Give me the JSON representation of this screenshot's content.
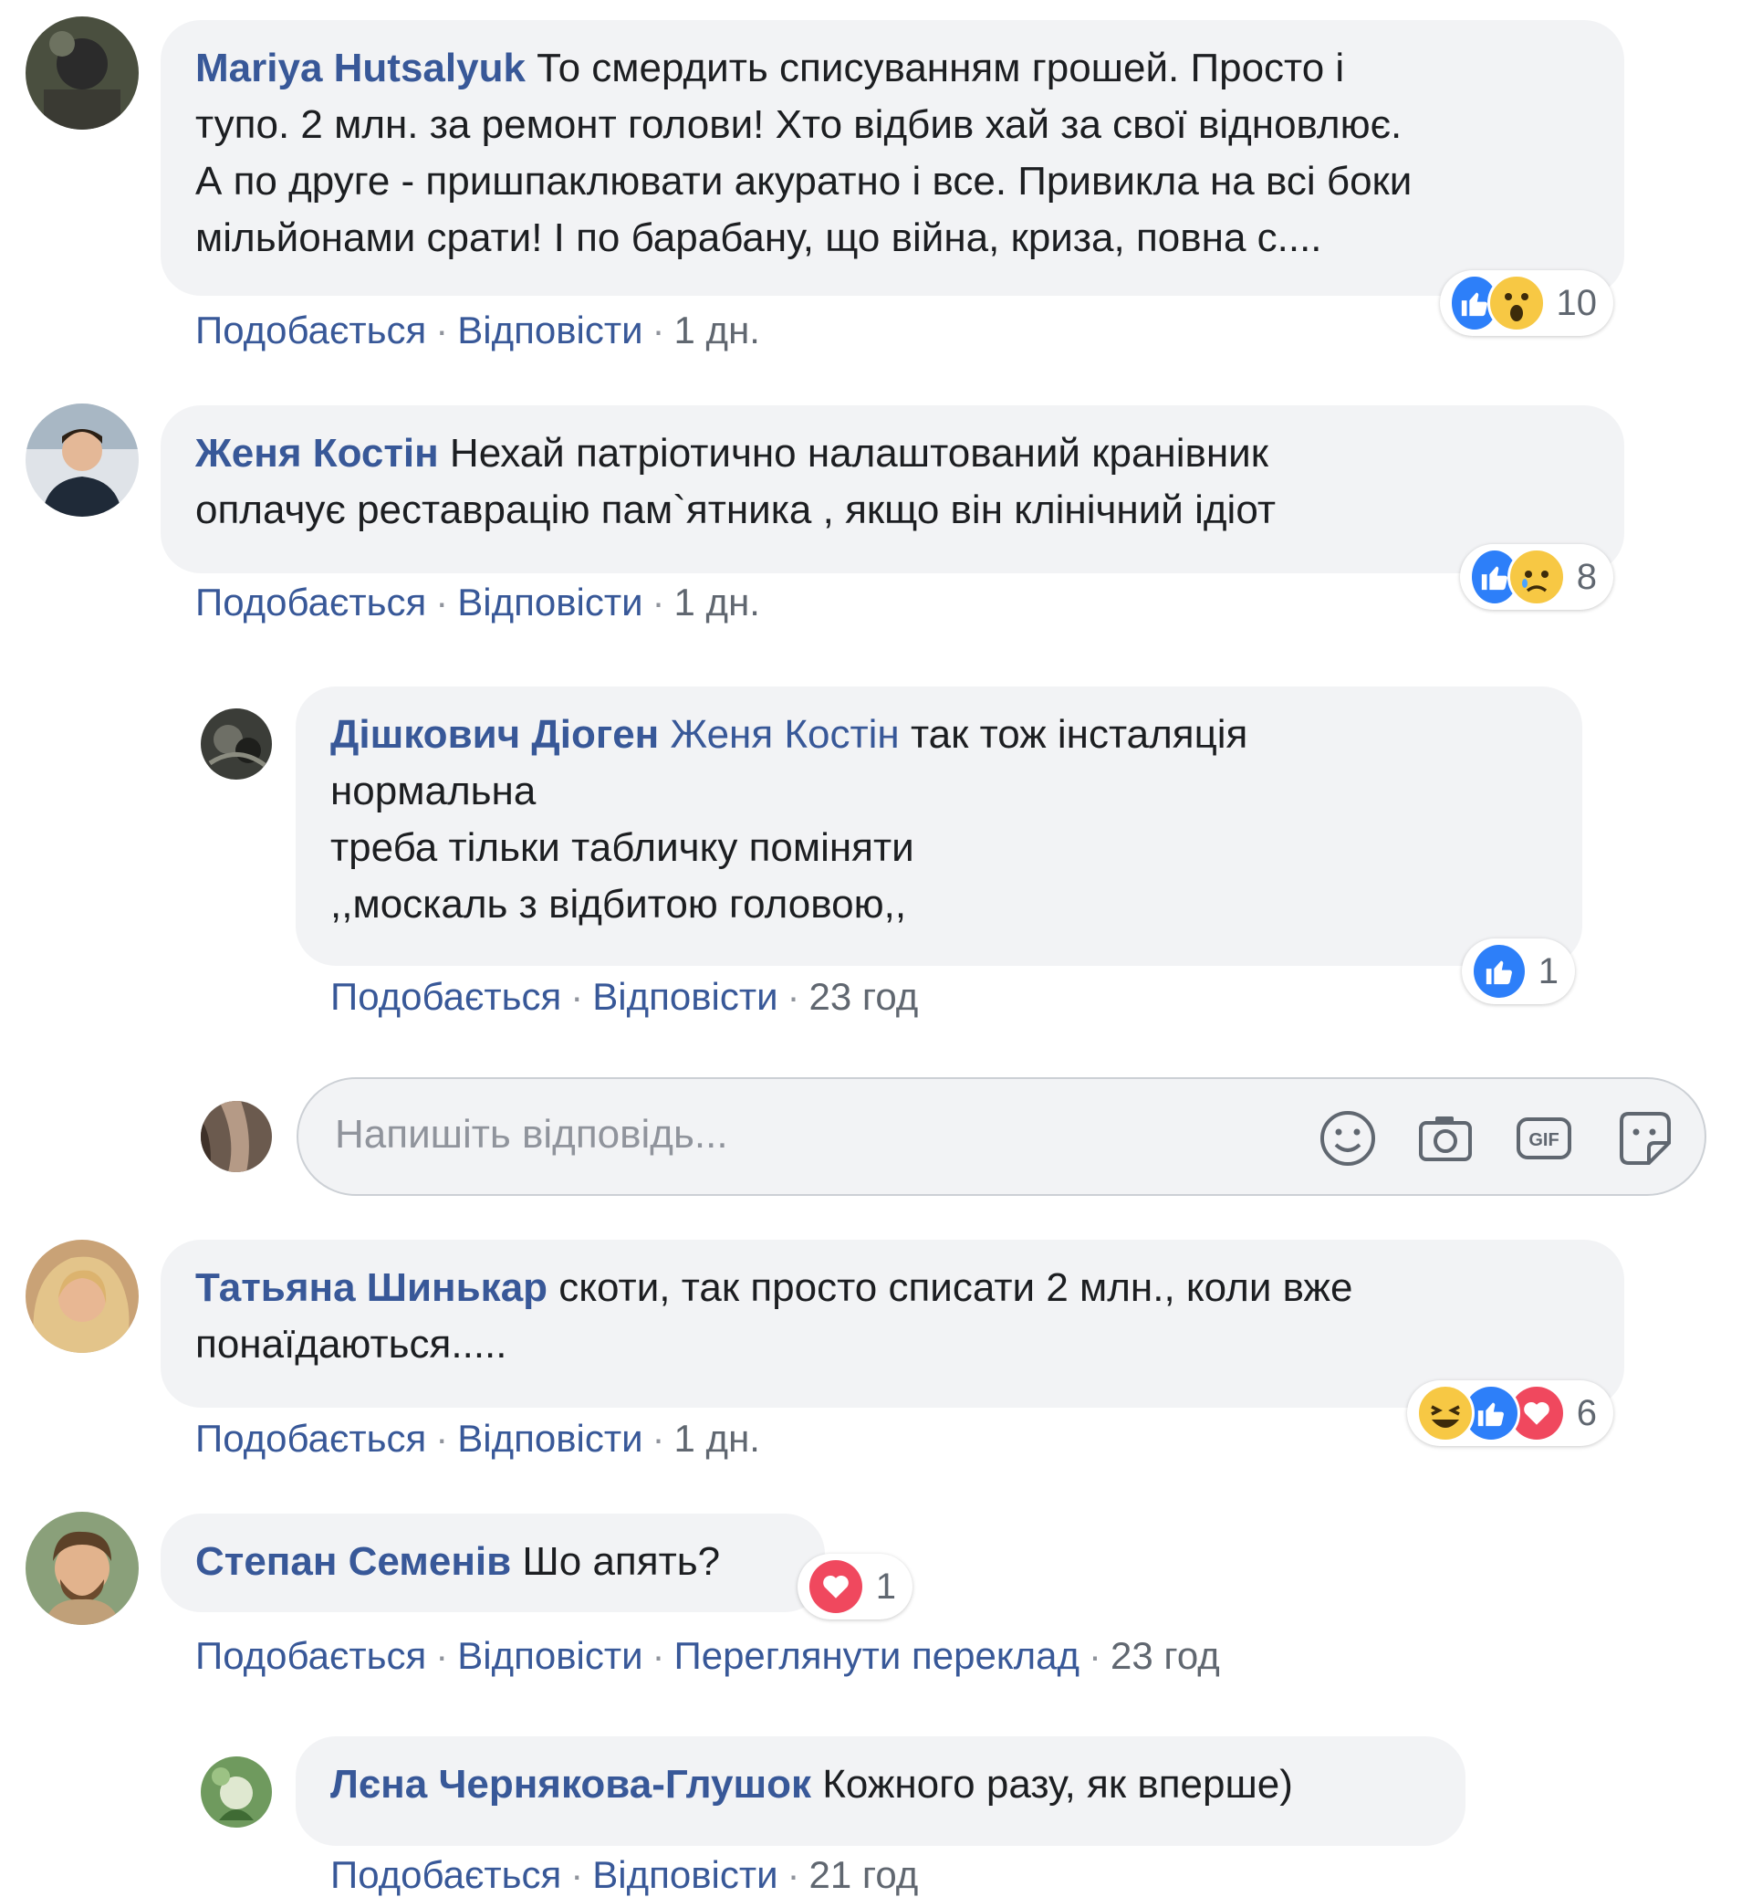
{
  "comments": [
    {
      "author": "Mariya Hutsalyuk",
      "text_lines": [
        "То смердить списуванням грошей. Просто і",
        "тупо. 2 млн. за ремонт голови! Хто відбив хай за свої відновлює.",
        "А по друге - пришпаклювати акуратно і все. Привикла на всі боки",
        "мільйонами срати! І по барабану, що війна, криза, повна с...."
      ],
      "like_label": "Подобається",
      "reply_label": "Відповісти",
      "time": "1 дн.",
      "reactions": {
        "icons": [
          "like-icon",
          "wow-icon"
        ],
        "count": "10"
      }
    },
    {
      "author": "Женя Костін",
      "text_lines": [
        "Нехай патріотично налаштований кранівник",
        "оплачує реставрацію пам`ятника , якщо він клінічний ідіот"
      ],
      "like_label": "Подобається",
      "reply_label": "Відповісти",
      "time": "1 дн.",
      "reactions": {
        "icons": [
          "like-icon",
          "sad-icon"
        ],
        "count": "8"
      },
      "replies": [
        {
          "author": "Дішкович Діоген",
          "mention": "Женя Костін",
          "text_lines": [
            "так тож інсталяція",
            "нормальна",
            "треба тільки табличку поміняти",
            ",,москаль з відбитою головою,,"
          ],
          "like_label": "Подобається",
          "reply_label": "Відповісти",
          "time": "23 год",
          "reactions": {
            "icons": [
              "like-icon"
            ],
            "count": "1"
          }
        }
      ]
    },
    {
      "author": "Татьяна Шинькар",
      "text_lines": [
        "скоти, так просто списати 2 млн., коли вже",
        "понаїдаються....."
      ],
      "like_label": "Подобається",
      "reply_label": "Відповісти",
      "time": "1 дн.",
      "reactions": {
        "icons": [
          "haha-icon",
          "like-icon",
          "love-icon"
        ],
        "count": "6"
      }
    },
    {
      "author": "Степан Семенів",
      "text_lines": [
        "Шо апять?"
      ],
      "like_label": "Подобається",
      "reply_label": "Відповісти",
      "translate_label": "Переглянути переклад",
      "time": "23 год",
      "reactions": {
        "icons": [
          "love-icon"
        ],
        "count": "1"
      },
      "replies": [
        {
          "author": "Лєна Чернякова-Глушок",
          "text_lines": [
            "Кожного разу, як вперше)"
          ],
          "like_label": "Подобається",
          "reply_label": "Відповісти",
          "time": "21 год"
        }
      ]
    }
  ],
  "reply_box": {
    "placeholder": "Напишіть відповідь...",
    "icons": [
      "emoji-icon",
      "camera-icon",
      "gif-icon",
      "sticker-icon"
    ],
    "gif_label": "GIF"
  },
  "colors": {
    "name": "#385898",
    "bubble": "#f2f3f5",
    "meta": "#606770",
    "like": "#2d7ff9",
    "love": "#f0485e",
    "yellow": "#f7c844"
  }
}
